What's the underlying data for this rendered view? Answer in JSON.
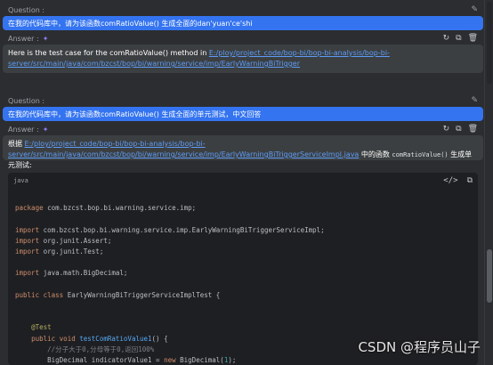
{
  "block1": {
    "question_label": "Question :",
    "question_text": "在我的代码库中，请为该函数comRatioValue() 生成全面的dan'yuan'ce'shi",
    "answer_label": "Answer :",
    "answer_prefix": "Here is the test case for the comRatioValue() method in ",
    "answer_link": "E:/ploy/project_code/bop-bi/bop-bi-analysis/bop-bi-server/src/main/java/com/bzcst/bop/bi/warning/service/imp/EarlyWarningBiTrigger"
  },
  "block2": {
    "question_label": "Question :",
    "question_text": "在我的代码库中，请为该函数comRatioValue() 生成全面的单元测试，中文回答",
    "answer_label": "Answer :",
    "answer_prefix": "根据 ",
    "answer_link": "E:/ploy/project_code/bop-bi/bop-bi-analysis/bop-bi-server/src/main/java/com/bzcst/bop/bi/warning/service/imp/EarlyWarningBiTriggerServiceImpl.java",
    "answer_mid": " 中的函数 ",
    "answer_code": "comRatioValue()",
    "answer_suffix": " 生成单元测试:"
  },
  "code": {
    "language": "java",
    "lines": [
      {
        "t": "plain",
        "s": ""
      },
      {
        "t": "raw",
        "h": "<span class='kw'>package</span> com.bzcst.bop.bi.warning.service.imp;"
      },
      {
        "t": "plain",
        "s": ""
      },
      {
        "t": "raw",
        "h": "<span class='kw'>import</span> com.bzcst.bop.bi.warning.service.imp.EarlyWarningBiTriggerServiceImpl;"
      },
      {
        "t": "raw",
        "h": "<span class='kw'>import</span> org.junit.Assert;"
      },
      {
        "t": "raw",
        "h": "<span class='kw'>import</span> org.junit.Test;"
      },
      {
        "t": "plain",
        "s": ""
      },
      {
        "t": "raw",
        "h": "<span class='kw'>import</span> java.math.BigDecimal;"
      },
      {
        "t": "plain",
        "s": ""
      },
      {
        "t": "raw",
        "h": "<span class='kw'>public class</span> EarlyWarningBiTriggerServiceImplTest {"
      },
      {
        "t": "plain",
        "s": ""
      },
      {
        "t": "plain",
        "s": ""
      },
      {
        "t": "raw",
        "h": "    <span class='ann'>@Test</span>"
      },
      {
        "t": "raw",
        "h": "    <span class='kw'>public void</span> <span class='fn'>testComRatioValue1</span>() {"
      },
      {
        "t": "raw",
        "h": "        <span class='cm'>//分子大于0,分母等于0,返回100%</span>"
      },
      {
        "t": "raw",
        "h": "        BigDecimal indicatorValue1 = <span class='kw'>new</span> BigDecimal(<span class='num'>1</span>);"
      }
    ]
  },
  "watermark": "CSDN @程序员山子"
}
